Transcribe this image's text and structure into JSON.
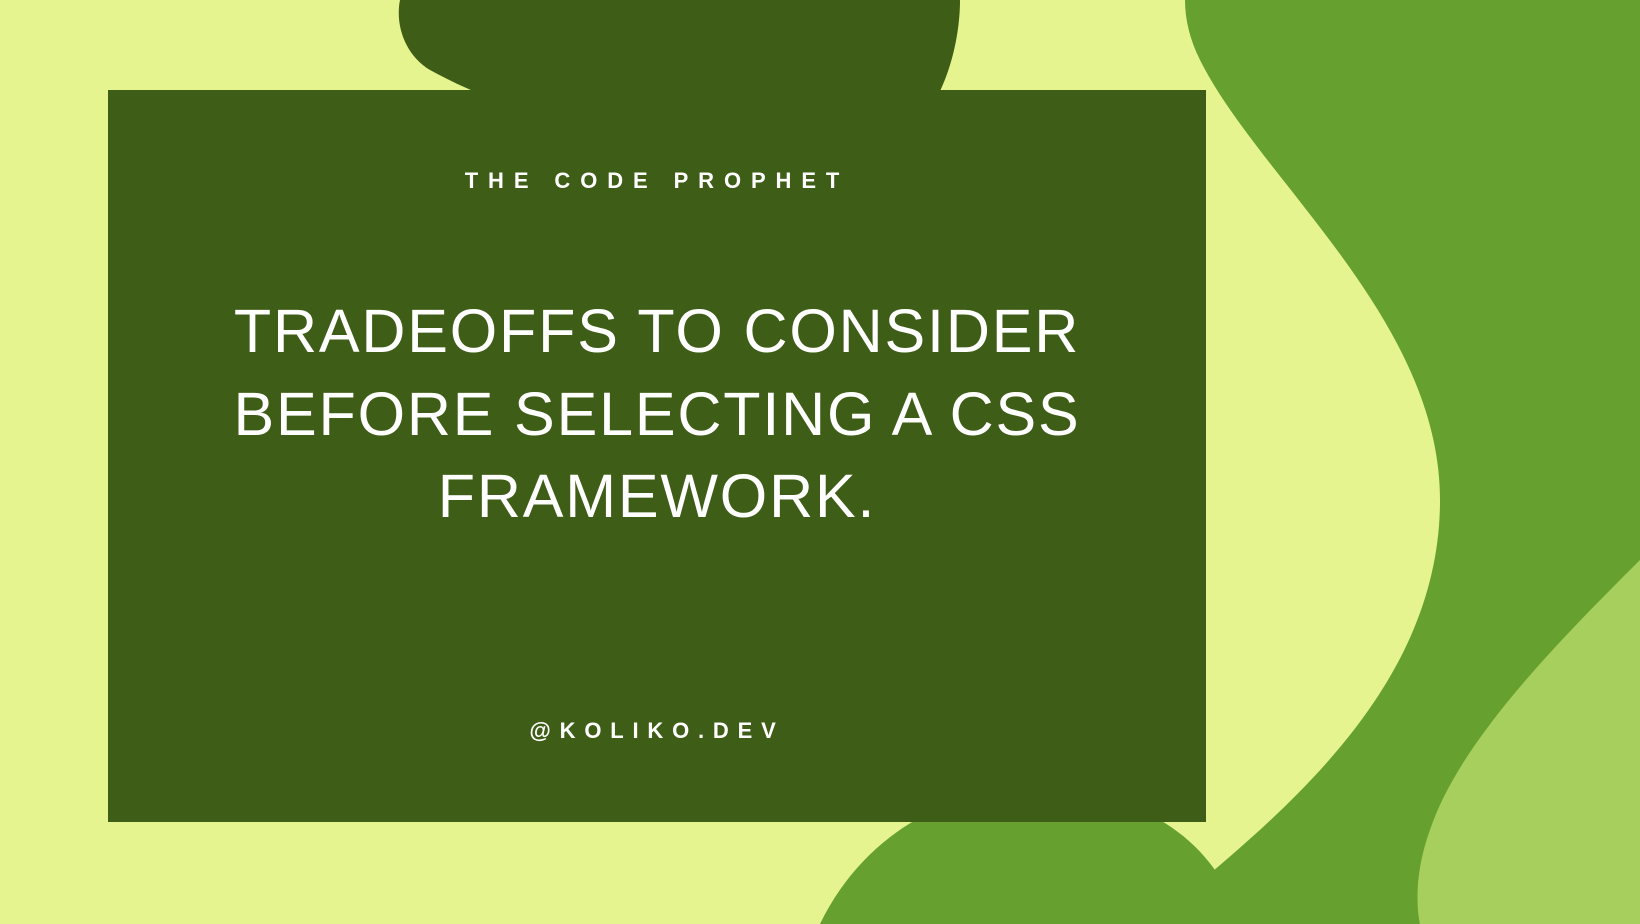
{
  "card": {
    "kicker": "THE CODE PROPHET",
    "title": "TRADEOFFS TO CONSIDER BEFORE SELECTING A CSS FRAMEWORK.",
    "handle": "@KOLIKO.DEV"
  },
  "colors": {
    "background_light": "#e6f48f",
    "card_bg": "#3e5d16",
    "accent_mid": "#66a12f",
    "accent_light": "#a7cf5e",
    "text": "#ffffff"
  }
}
